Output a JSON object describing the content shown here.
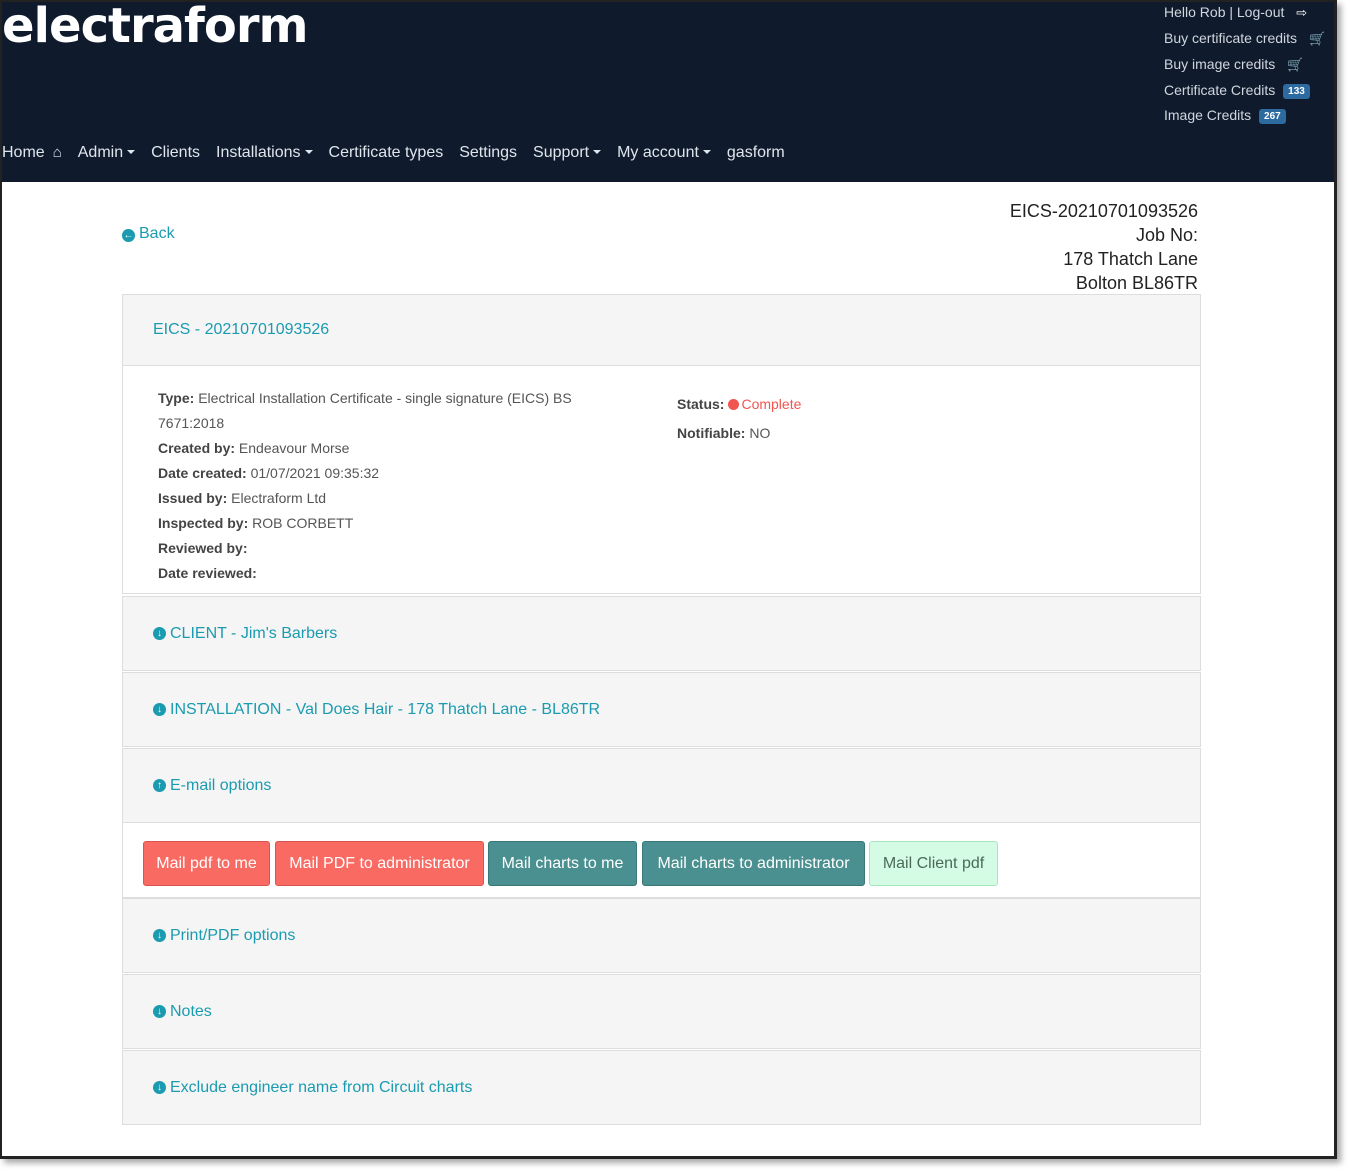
{
  "header": {
    "logo": "electraform",
    "user_links": "Hello Rob | Log-out",
    "buy_cert": "Buy certificate credits",
    "buy_image": "Buy image credits",
    "cert_credits_label": "Certificate Credits",
    "cert_credits": "133",
    "image_credits_label": "Image Credits",
    "image_credits": "267"
  },
  "menu": {
    "home": "Home",
    "admin": "Admin",
    "clients": "Clients",
    "installations": "Installations",
    "cert_types": "Certificate types",
    "settings": "Settings",
    "support": "Support",
    "my_account": "My account",
    "gasform": "gasform"
  },
  "page": {
    "back": "Back",
    "cert_ref": "EICS-20210701093526",
    "job_no": "Job No:",
    "address1": "178 Thatch Lane",
    "address2": "Bolton BL86TR"
  },
  "cert": {
    "title": "EICS - 20210701093526",
    "type_label": "Type:",
    "type_value": "Electrical Installation Certificate - single signature (EICS) BS",
    "type_value2": "7671:2018",
    "created_by_label": "Created by:",
    "created_by": "Endeavour Morse",
    "date_created_label": "Date created:",
    "date_created": "01/07/2021 09:35:32",
    "issued_by_label": "Issued by:",
    "issued_by": "Electraform Ltd",
    "inspected_by_label": "Inspected by:",
    "inspected_by": "ROB CORBETT",
    "reviewed_by_label": "Reviewed by:",
    "date_reviewed_label": "Date reviewed:",
    "status_label": "Status:",
    "status": "Complete",
    "notifiable_label": "Notifiable:",
    "notifiable": "NO"
  },
  "sections": {
    "client": "CLIENT - Jim's Barbers",
    "installation": "INSTALLATION - Val Does Hair - 178 Thatch Lane - BL86TR",
    "email": "E-mail options",
    "print": "Print/PDF options",
    "notes": "Notes",
    "exclude": "Exclude engineer name from Circuit charts"
  },
  "buttons": {
    "mail_pdf_me": "Mail pdf to me",
    "mail_pdf_admin": "Mail PDF to administrator",
    "mail_charts_me": "Mail charts to me",
    "mail_charts_admin": "Mail charts to administrator",
    "mail_client_pdf": "Mail Client pdf"
  },
  "colors": {
    "navbar": "#0f1b2c",
    "link": "#1a9bb0",
    "red_button": "#f96a63",
    "teal_button": "#4a9090",
    "green_button": "#d4fbe3",
    "status": "#f0554f"
  }
}
